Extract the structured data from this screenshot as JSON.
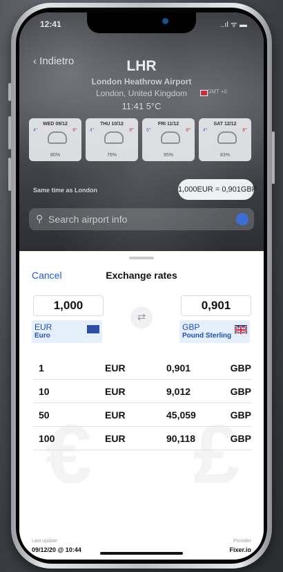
{
  "status": {
    "time": "12:41",
    "icons": "..ıl ᯤ ▬"
  },
  "header": {
    "back_label": "Indietro",
    "code": "LHR",
    "airport_name": "London Heathrow Airport",
    "city": "London, United Kingdom",
    "gmt": "GMT +0",
    "local_time": "11:41",
    "temperature": "5°C"
  },
  "forecast": [
    {
      "date": "WED 09/12",
      "lo": "4°",
      "hi": "8°",
      "rain": "80%"
    },
    {
      "date": "THU 10/12",
      "lo": "4°",
      "hi": "8°",
      "rain": "76%"
    },
    {
      "date": "FRI 11/12",
      "lo": "6°",
      "hi": "8°",
      "rain": "95%"
    },
    {
      "date": "SAT 12/12",
      "lo": "4°",
      "hi": "8°",
      "rain": "83%"
    }
  ],
  "same_time": "Same time as London",
  "exchange_pill": {
    "from_amount": "1,000",
    "from_code": "EUR",
    "to_amount": "0,901",
    "to_code": "GBP"
  },
  "search": {
    "placeholder": "Search airport info"
  },
  "sheet": {
    "cancel_label": "Cancel",
    "title": "Exchange rates",
    "from": {
      "amount": "1,000",
      "code": "EUR",
      "name": "Euro"
    },
    "to": {
      "amount": "0,901",
      "code": "GBP",
      "name": "Pound Sterling"
    },
    "rates": [
      {
        "from_amount": "1",
        "from_code": "EUR",
        "to_amount": "0,901",
        "to_code": "GBP"
      },
      {
        "from_amount": "10",
        "from_code": "EUR",
        "to_amount": "9,012",
        "to_code": "GBP"
      },
      {
        "from_amount": "50",
        "from_code": "EUR",
        "to_amount": "45,059",
        "to_code": "GBP"
      },
      {
        "from_amount": "100",
        "from_code": "EUR",
        "to_amount": "90,118",
        "to_code": "GBP"
      }
    ],
    "watermark_left": "€",
    "watermark_right": "£",
    "footer": {
      "last_update_label": "Last update",
      "last_update_value": "09/12/20 @ 10:44",
      "provider_label": "Provider",
      "provider_value": "Fixer.io"
    }
  },
  "colors": {
    "accent": "#1e5bd0",
    "currency_bg": "#e5eefb",
    "search_button": "#3d6fd2"
  }
}
